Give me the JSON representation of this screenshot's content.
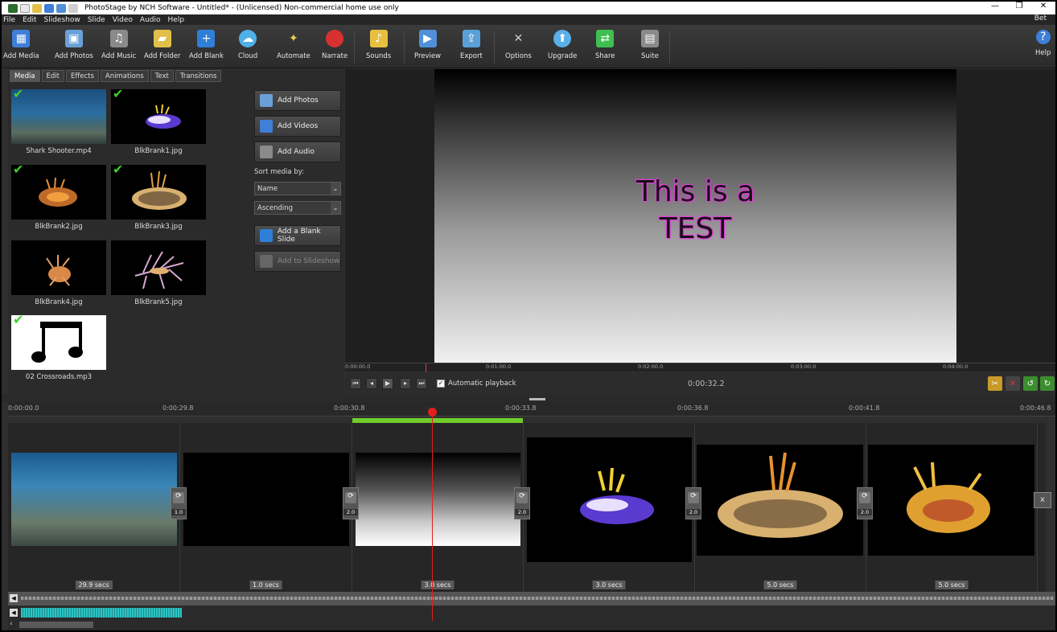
{
  "window": {
    "title": "PhotoStage by NCH Software - Untitled* - (Unlicensed) Non-commercial home use only",
    "controls": [
      "—",
      "❐",
      "✕"
    ]
  },
  "menu": {
    "items": [
      "File",
      "Edit",
      "Slideshow",
      "Slide",
      "Video",
      "Audio",
      "Help"
    ],
    "right": "Bet"
  },
  "toolbar": {
    "buttons": [
      {
        "label": "Add Media",
        "icon": "add-media-icon",
        "color": "#3f7fd8"
      },
      {
        "label": "Add Photos",
        "icon": "add-photos-icon",
        "color": "#6aa0d8"
      },
      {
        "label": "Add Music",
        "icon": "add-music-icon",
        "color": "#9a9a9a"
      },
      {
        "label": "Add Folder",
        "icon": "add-folder-icon",
        "color": "#e0c04a"
      },
      {
        "label": "Add Blank",
        "icon": "add-blank-icon",
        "color": "#2f7fd8"
      },
      {
        "label": "Cloud",
        "icon": "cloud-icon",
        "color": "#4fb0e8"
      },
      {
        "label": "Automate",
        "icon": "automate-icon",
        "color": "#e8d04a"
      },
      {
        "label": "Narrate",
        "icon": "narrate-icon",
        "color": "#d83030"
      },
      {
        "label": "Sounds",
        "icon": "sounds-icon",
        "color": "#e8c040"
      },
      {
        "label": "Preview",
        "icon": "preview-icon",
        "color": "#4f90d8"
      },
      {
        "label": "Export",
        "icon": "export-icon",
        "color": "#5aa0d8"
      },
      {
        "label": "Options",
        "icon": "options-icon",
        "color": "#b0b0b0"
      },
      {
        "label": "Upgrade",
        "icon": "upgrade-icon",
        "color": "#5ab0e8"
      },
      {
        "label": "Share",
        "icon": "share-icon",
        "color": "#3fbf4f"
      },
      {
        "label": "Suite",
        "icon": "suite-icon",
        "color": "#9a9a9a"
      },
      {
        "label": "Help",
        "icon": "help-icon",
        "color": "#3f7fd8"
      }
    ]
  },
  "left_panel": {
    "tabs": [
      "Media",
      "Edit",
      "Effects",
      "Animations",
      "Text",
      "Transitions"
    ],
    "active_tab": "Media",
    "media_items": [
      {
        "name": "Shark Shooter.mp4",
        "checked": true
      },
      {
        "name": "BlkBrank1.jpg",
        "checked": true
      },
      {
        "name": "BlkBrank2.jpg",
        "checked": true
      },
      {
        "name": "BlkBrank3.jpg",
        "checked": true
      },
      {
        "name": "BlkBrank4.jpg",
        "checked": false
      },
      {
        "name": "BlkBrank5.jpg",
        "checked": false
      },
      {
        "name": "02 Crossroads.mp3",
        "checked": true
      }
    ],
    "buttons": {
      "add_photos": "Add Photos",
      "add_videos": "Add Videos",
      "add_audio": "Add Audio",
      "sort_label": "Sort media by:",
      "sort_by": "Name",
      "sort_order": "Ascending",
      "add_blank_slide": "Add a Blank Slide",
      "add_to_slideshow": "Add to Slideshow"
    }
  },
  "preview": {
    "slide_text_line1": "This is a",
    "slide_text_line2": "TEST",
    "ruler_ticks": [
      "0:00:00.0",
      "0:01:00.0",
      "0:02:00.0",
      "0:03:00.0",
      "0:04:00.0"
    ],
    "automatic_playback_label": "Automatic playback",
    "automatic_playback": true,
    "timecode": "0:00:32.2"
  },
  "timeline": {
    "ruler_ticks": [
      "0:00:00.0",
      "0:00:29.8",
      "0:00:30.8",
      "0:00:33.8",
      "0:00:36.8",
      "0:00:41.8",
      "0:00:46.8"
    ],
    "clips": [
      {
        "duration": "29.9 secs",
        "kind": "underwater-reef"
      },
      {
        "duration": "1.0 secs",
        "kind": "black"
      },
      {
        "duration": "3.0 secs",
        "kind": "gradient"
      },
      {
        "duration": "3.0 secs",
        "kind": "nudibranch-purple"
      },
      {
        "duration": "5.0 secs",
        "kind": "nudibranch-orange"
      },
      {
        "duration": "5.0 secs",
        "kind": "nudibranch-yellow"
      }
    ],
    "transitions": [
      "1.0",
      "2.0",
      "2.0",
      "2.0",
      "2.0"
    ],
    "end_marker": "x"
  }
}
